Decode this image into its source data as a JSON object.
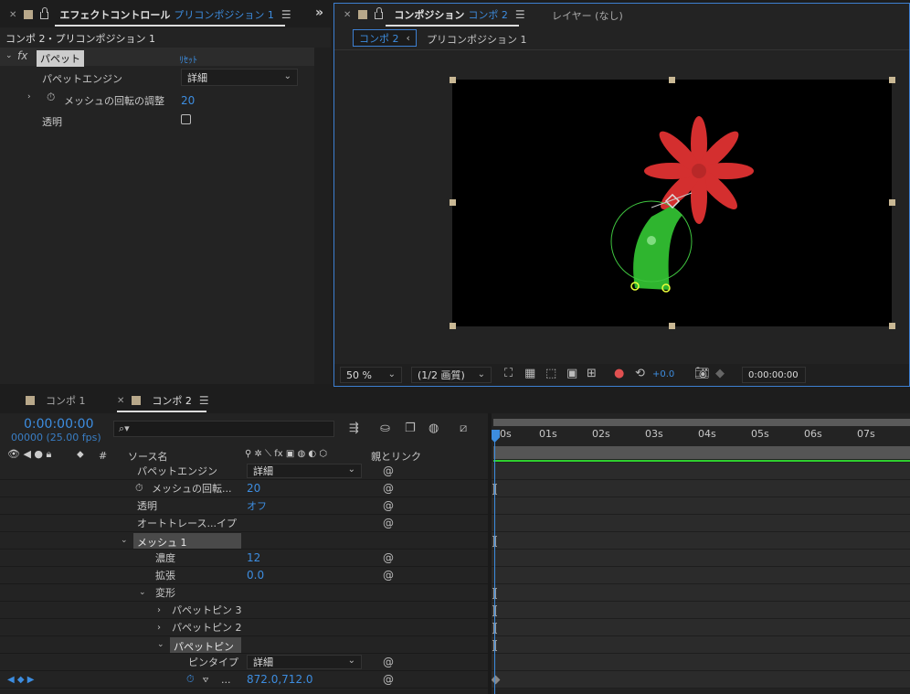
{
  "effects_panel": {
    "tab_title": "エフェクトコントロール",
    "tab_layer": "プリコンポジション 1",
    "breadcrumb": "コンポ 2・プリコンポジション 1",
    "effect_name": "パペット",
    "reset_label": "ﾘｾｯﾄ",
    "props": [
      {
        "label": "パペットエンジン",
        "value": "詳細"
      },
      {
        "label": "メッシュの回転の調整",
        "value": "20"
      },
      {
        "label": "透明",
        "value": ""
      }
    ]
  },
  "comp_panel": {
    "tab_title": "コンポジション",
    "tab_comp": "コンポ 2",
    "layer_tab": "レイヤー (なし)",
    "crumb_active": "コンポ 2",
    "crumb_next": "プリコンポジション 1",
    "zoom": "50 %",
    "resolution": "(1/2 画質)",
    "exposure": "+0.0",
    "timecode": "0:00:00:00"
  },
  "timeline": {
    "tabs": [
      "コンポ 1",
      "コンポ 2"
    ],
    "timecode": "0:00:00:00",
    "fps": "00000 (25.00 fps)",
    "search_placeholder": "",
    "col_num": "#",
    "col_source": "ソース名",
    "col_parent": "親とリンク",
    "ruler": [
      "00s",
      "01s",
      "02s",
      "03s",
      "04s",
      "05s",
      "06s",
      "07s"
    ],
    "rows": [
      {
        "label": "パペットエンジン",
        "value": "詳細"
      },
      {
        "label": "メッシュの回転...",
        "value": "20"
      },
      {
        "label": "透明",
        "value": "オフ"
      },
      {
        "label": "オートトレース...イプ",
        "value": ""
      },
      {
        "label": "メッシュ 1",
        "value": ""
      },
      {
        "label": "濃度",
        "value": "12"
      },
      {
        "label": "拡張",
        "value": "0.0"
      },
      {
        "label": "変形",
        "value": ""
      },
      {
        "label": "パペットピン 3",
        "value": ""
      },
      {
        "label": "パペットピン 2",
        "value": ""
      },
      {
        "label": "パペットピン 1",
        "value": ""
      },
      {
        "label": "ピンタイプ",
        "value": "詳細"
      },
      {
        "label": "...",
        "value": "872.0,712.0"
      }
    ]
  },
  "colors": {
    "accent": "#3d8de0",
    "petal": "#d42f2f",
    "stem": "#2fb52f",
    "bg": "#232323"
  }
}
